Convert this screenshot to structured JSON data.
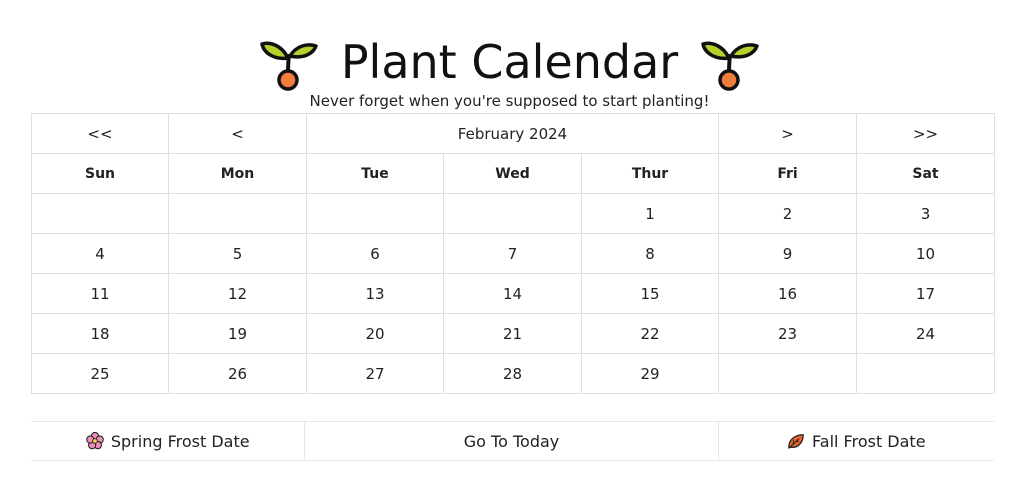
{
  "header": {
    "title": "Plant Calendar",
    "subtitle": "Never forget when you're supposed to start planting!"
  },
  "nav": {
    "prev_year": "<<",
    "prev_month": "<",
    "month_label": "February 2024",
    "next_month": ">",
    "next_year": ">>"
  },
  "weekdays": [
    "Sun",
    "Mon",
    "Tue",
    "Wed",
    "Thur",
    "Fri",
    "Sat"
  ],
  "weeks": [
    [
      "",
      "",
      "",
      "",
      "1",
      "2",
      "3"
    ],
    [
      "4",
      "5",
      "6",
      "7",
      "8",
      "9",
      "10"
    ],
    [
      "11",
      "12",
      "13",
      "14",
      "15",
      "16",
      "17"
    ],
    [
      "18",
      "19",
      "20",
      "21",
      "22",
      "23",
      "24"
    ],
    [
      "25",
      "26",
      "27",
      "28",
      "29",
      "",
      ""
    ]
  ],
  "actions": {
    "spring_frost": "Spring Frost Date",
    "go_today": "Go To Today",
    "fall_frost": "Fall Frost Date"
  },
  "icons": {
    "title_left": "seedling-icon",
    "title_right": "seedling-icon",
    "spring": "cherry-blossom-icon",
    "fall": "fallen-leaf-icon"
  },
  "colors": {
    "leaf": "#b5cf2b",
    "seed": "#f07d3a",
    "blossom": "#f08fb8",
    "fall_leaf": "#e8642a",
    "border": "#e0e0e0"
  }
}
